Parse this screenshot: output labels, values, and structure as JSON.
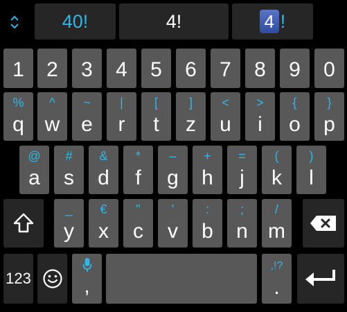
{
  "suggestions": [
    {
      "text": "40!"
    },
    {
      "text": "4!"
    },
    {
      "highlight": "4",
      "tail": "!"
    }
  ],
  "rows": {
    "numbers": [
      "1",
      "2",
      "3",
      "4",
      "5",
      "6",
      "7",
      "8",
      "9",
      "0"
    ],
    "row2": [
      {
        "key": "q",
        "alt": "%"
      },
      {
        "key": "w",
        "alt": "^"
      },
      {
        "key": "e",
        "alt": "~"
      },
      {
        "key": "r",
        "alt": "|"
      },
      {
        "key": "t",
        "alt": "["
      },
      {
        "key": "z",
        "alt": "]"
      },
      {
        "key": "u",
        "alt": "<"
      },
      {
        "key": "i",
        "alt": ">"
      },
      {
        "key": "o",
        "alt": "{"
      },
      {
        "key": "p",
        "alt": "}"
      }
    ],
    "row3": [
      {
        "key": "a",
        "alt": "@"
      },
      {
        "key": "s",
        "alt": "#"
      },
      {
        "key": "d",
        "alt": "&"
      },
      {
        "key": "f",
        "alt": "*"
      },
      {
        "key": "g",
        "alt": "–"
      },
      {
        "key": "h",
        "alt": "+"
      },
      {
        "key": "j",
        "alt": "="
      },
      {
        "key": "k",
        "alt": "("
      },
      {
        "key": "l",
        "alt": ")"
      }
    ],
    "row4": [
      {
        "key": "y",
        "alt": "_"
      },
      {
        "key": "x",
        "alt": "€"
      },
      {
        "key": "c",
        "alt": "\""
      },
      {
        "key": "v",
        "alt": "'"
      },
      {
        "key": "b",
        "alt": ":"
      },
      {
        "key": "n",
        "alt": ";"
      },
      {
        "key": "m",
        "alt": "/"
      }
    ]
  },
  "bottom": {
    "symbols_label": "123",
    "comma_label": ",",
    "period_label": ".",
    "period_alt": ",!?"
  },
  "colors": {
    "accent": "#33b5e5",
    "key": "#585858",
    "dark_key": "#262626"
  },
  "icons": [
    "chevron-up-down-icon",
    "shift-icon",
    "backspace-icon",
    "emoji-icon",
    "mic-icon",
    "enter-icon"
  ]
}
